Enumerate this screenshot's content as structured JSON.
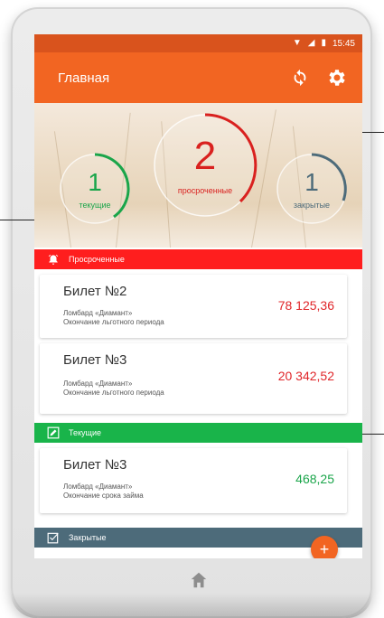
{
  "status_bar": {
    "time": "15:45",
    "icons": [
      "wifi-icon",
      "signal-icon",
      "battery-icon"
    ]
  },
  "app_bar": {
    "title": "Главная"
  },
  "summary": {
    "current": {
      "count": "1",
      "label": "текущие",
      "color": "#1aa54a"
    },
    "overdue": {
      "count": "2",
      "label": "просроченные",
      "color": "#d9211f"
    },
    "closed": {
      "count": "1",
      "label": "закрытые",
      "color": "#4d6b7a"
    }
  },
  "sections": {
    "overdue": {
      "title": "Просроченные",
      "color": "#ff1e1e",
      "items": [
        {
          "ticket": "Билет №2",
          "pawnshop": "Ломбард «Диамант»",
          "note": "Окончание льготного периода",
          "amount": "78 125,36"
        },
        {
          "ticket": "Билет №3",
          "pawnshop": "Ломбард «Диамант»",
          "note": "Окончание льготного периода",
          "amount": "20 342,52"
        }
      ]
    },
    "current": {
      "title": "Текущие",
      "color": "#19b44a",
      "items": [
        {
          "ticket": "Билет №3",
          "pawnshop": "Ломбард «Диамант»",
          "note": "Окончание срока займа",
          "amount": "468,25"
        }
      ]
    },
    "closed": {
      "title": "Закрытые",
      "color": "#4d6b7a"
    }
  },
  "colors": {
    "accent": "#f26522",
    "status_bar": "#d9531d",
    "overdue_amount": "#e0262a",
    "current_amount": "#1aa54a"
  }
}
